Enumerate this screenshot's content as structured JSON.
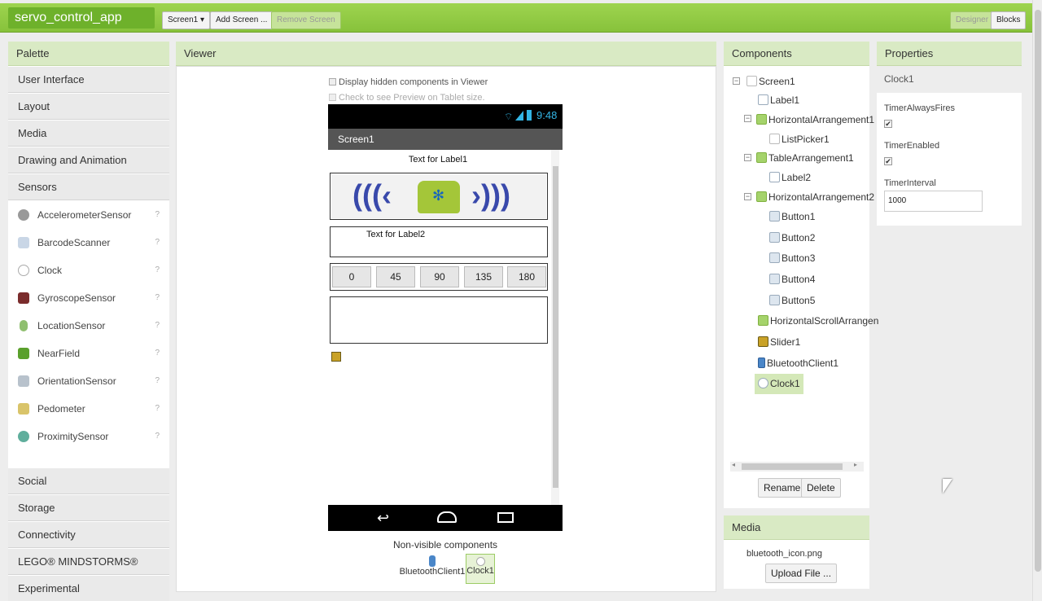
{
  "app": {
    "title": "servo_control_app"
  },
  "toolbar": {
    "screen_select": "Screen1 ▾",
    "add_screen": "Add Screen ...",
    "remove_screen": "Remove Screen",
    "designer": "Designer",
    "blocks": "Blocks"
  },
  "palette": {
    "header": "Palette",
    "categories_top": [
      "User Interface",
      "Layout",
      "Media",
      "Drawing and Animation",
      "Sensors"
    ],
    "sensor_items": [
      {
        "label": "AccelerometerSensor",
        "icon": "accelerometer-icon"
      },
      {
        "label": "BarcodeScanner",
        "icon": "barcode-icon"
      },
      {
        "label": "Clock",
        "icon": "clock-icon"
      },
      {
        "label": "GyroscopeSensor",
        "icon": "gyroscope-icon"
      },
      {
        "label": "LocationSensor",
        "icon": "location-icon"
      },
      {
        "label": "NearField",
        "icon": "nearfield-icon"
      },
      {
        "label": "OrientationSensor",
        "icon": "orientation-icon"
      },
      {
        "label": "Pedometer",
        "icon": "pedometer-icon"
      },
      {
        "label": "ProximitySensor",
        "icon": "proximity-icon"
      }
    ],
    "help_glyph": "?",
    "categories_bottom": [
      "Social",
      "Storage",
      "Connectivity",
      "LEGO® MINDSTORMS®",
      "Experimental"
    ]
  },
  "viewer": {
    "header": "Viewer",
    "display_hidden": "Display hidden components in Viewer",
    "tablet_preview": "Check to see Preview on Tablet size.",
    "status_time": "9:48",
    "screen_title": "Screen1",
    "label1": "Text for Label1",
    "label2": "Text for Label2",
    "buttons": [
      "0",
      "45",
      "90",
      "135",
      "180"
    ],
    "non_visible_title": "Non-visible components",
    "non_visible": [
      "BluetoothClient1",
      "Clock1"
    ]
  },
  "components": {
    "header": "Components",
    "tree": [
      {
        "label": "Screen1",
        "level": 0,
        "expander": "minus"
      },
      {
        "label": "Label1",
        "level": 1
      },
      {
        "label": "HorizontalArrangement1",
        "level": 1,
        "expander": "minus"
      },
      {
        "label": "ListPicker1",
        "level": 2
      },
      {
        "label": "TableArrangement1",
        "level": 1,
        "expander": "minus"
      },
      {
        "label": "Label2",
        "level": 2
      },
      {
        "label": "HorizontalArrangement2",
        "level": 1,
        "expander": "minus"
      },
      {
        "label": "Button1",
        "level": 2
      },
      {
        "label": "Button2",
        "level": 2
      },
      {
        "label": "Button3",
        "level": 2
      },
      {
        "label": "Button4",
        "level": 2
      },
      {
        "label": "Button5",
        "level": 2
      },
      {
        "label": "HorizontalScrollArrangen",
        "level": 1
      },
      {
        "label": "Slider1",
        "level": 1
      },
      {
        "label": "BluetoothClient1",
        "level": 1
      },
      {
        "label": "Clock1",
        "level": 1,
        "selected": true
      }
    ],
    "rename": "Rename",
    "delete": "Delete"
  },
  "media": {
    "header": "Media",
    "file": "bluetooth_icon.png",
    "upload": "Upload File ..."
  },
  "properties": {
    "header": "Properties",
    "component": "Clock1",
    "timer_always_fires": "TimerAlwaysFires",
    "timer_always_fires_value": true,
    "timer_enabled": "TimerEnabled",
    "timer_enabled_value": true,
    "timer_interval": "TimerInterval",
    "timer_interval_value": "1000",
    "check_glyph": "✔"
  },
  "colors": {
    "topbar": "#8bc34a",
    "panel_header": "#d9eac4",
    "selected": "#d4e8b8",
    "android_green": "#a4c639",
    "bluetooth_blue": "#3f51b5"
  }
}
